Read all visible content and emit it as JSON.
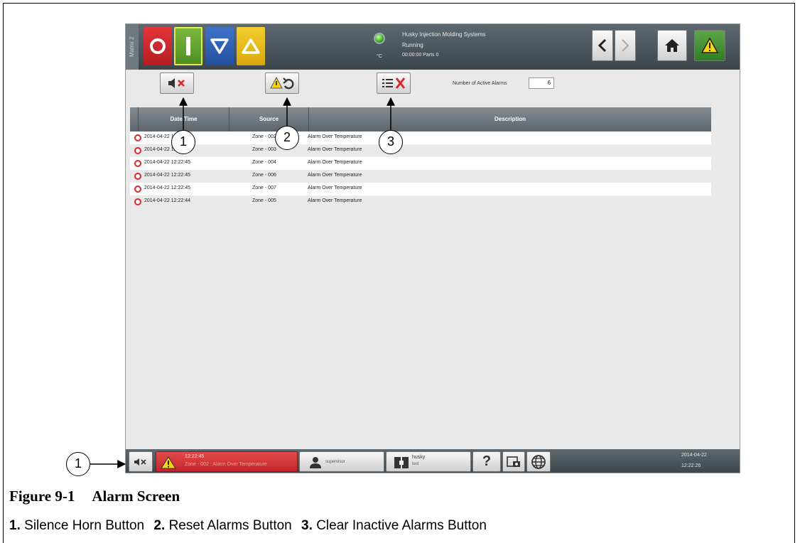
{
  "header": {
    "matrix_label": "Matrix 2",
    "machine_name": "Husky Injection Molding Systems",
    "machine_state": "Running",
    "cycle_info": "00:00:00   Parts 0",
    "temp_unit": "°C",
    "status_color": "#3eb32a"
  },
  "toolbar": {
    "silence_icon": "speaker-mute-icon",
    "reset_icon": "warning-reset-icon",
    "clear_icon": "list-clear-icon",
    "active_alarms_label": "Number of Active Alarms",
    "active_alarms_count": "6"
  },
  "table": {
    "headers": [
      "Date/Time",
      "Source",
      "Description"
    ],
    "rows": [
      {
        "date": "2014-04-22 12:22:45",
        "source": "Zone - 002",
        "description": "Alarm Over Temperature"
      },
      {
        "date": "2014-04-22 12:22:45",
        "source": "Zone - 003",
        "description": "Alarm Over Temperature"
      },
      {
        "date": "2014-04-22 12:22:45",
        "source": "Zone - 004",
        "description": "Alarm Over Temperature"
      },
      {
        "date": "2014-04-22 12:22:45",
        "source": "Zone - 006",
        "description": "Alarm Over Temperature"
      },
      {
        "date": "2014-04-22 12:22:45",
        "source": "Zone - 007",
        "description": "Alarm Over Temperature"
      },
      {
        "date": "2014-04-22 12:22:44",
        "source": "Zone - 005",
        "description": "Alarm Over Temperature"
      }
    ]
  },
  "bottom_bar": {
    "alarm_time": "12:22:45",
    "alarm_text": "Zone - 002 : Alarm Over Temperature",
    "user_name": "supervisor",
    "mold_name": "husky",
    "mold_sub": "test",
    "help_label": "?",
    "date": "2014-04-22",
    "time": "12:22:26"
  },
  "callouts": {
    "c1_top": "1",
    "c2": "2",
    "c3": "3",
    "c1_bottom": "1"
  },
  "caption": {
    "figure_number": "Figure 9-1",
    "figure_title": "Alarm Screen",
    "legend": [
      {
        "num": "1.",
        "text": "Silence Horn Button"
      },
      {
        "num": "2.",
        "text": "Reset Alarms Button"
      },
      {
        "num": "3.",
        "text": "Clear Inactive Alarms Button"
      }
    ]
  },
  "colors": {
    "alarm_red": "#d9272d",
    "mode_off": "#e2363a",
    "mode_on": "#7ab83e",
    "mode_manual": "#3f73c8",
    "mode_alarm": "#f3cf2d"
  }
}
